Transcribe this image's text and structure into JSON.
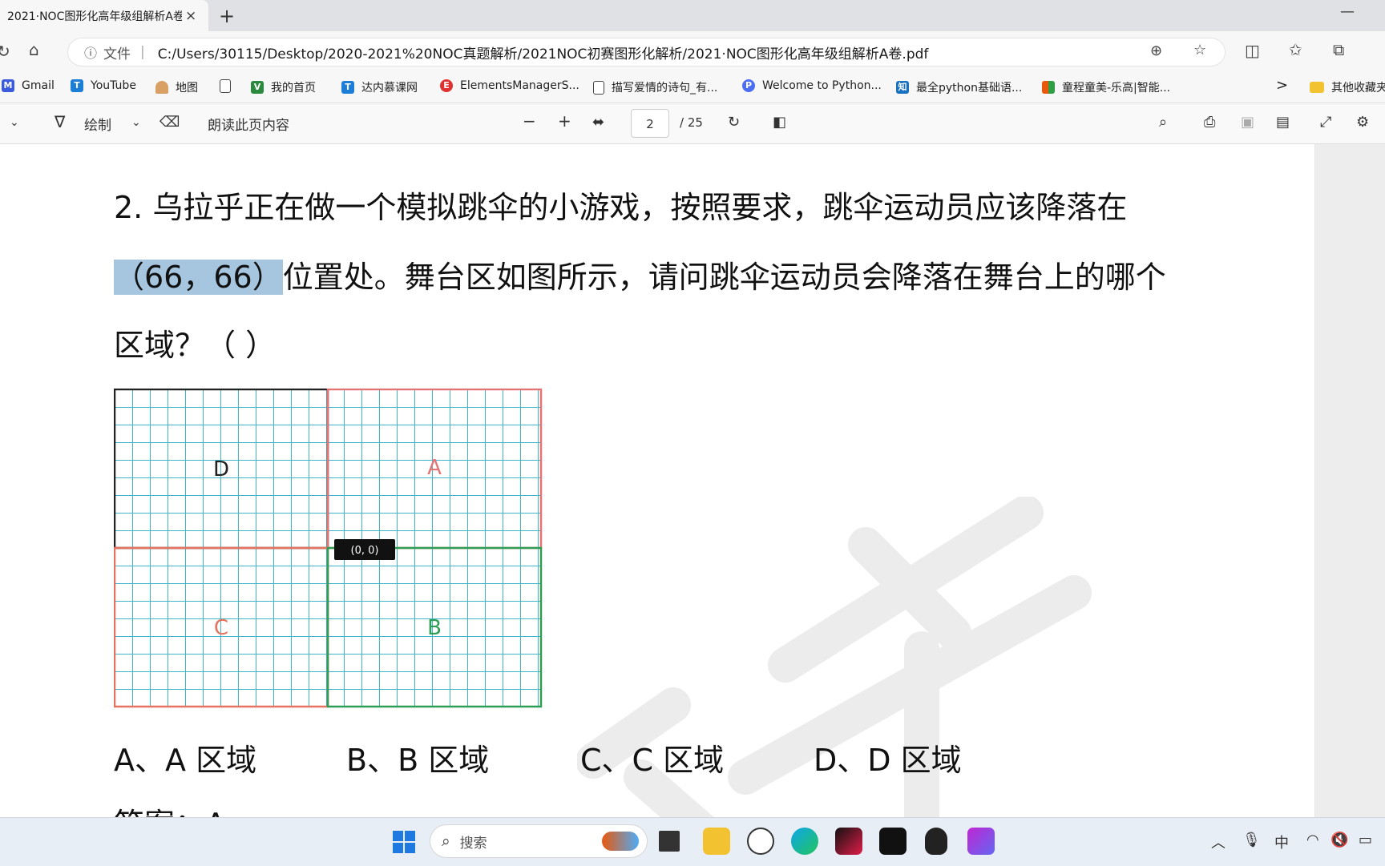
{
  "browser": {
    "tab_title": "2021·NOC图形化高年级组解析A卷",
    "close_glyph": "×",
    "new_tab_glyph": "+",
    "minimize_glyph": "—",
    "address": {
      "scheme_label": "文件",
      "separator": "|",
      "url": "C:/Users/30115/Desktop/2020-2021%20NOC真题解析/2021NOC初赛图形化解析/2021·NOC图形化高年级组解析A卷.pdf"
    },
    "bookmarks": [
      {
        "label": "Gmail",
        "color": "#3b5bdb",
        "glyph": "M"
      },
      {
        "label": "YouTube",
        "color": "#1c7ed6",
        "glyph": "T"
      },
      {
        "label": "地图",
        "color": "#d9a066",
        "glyph": ""
      },
      {
        "label": "",
        "color": "#ffffff",
        "glyph": ""
      },
      {
        "label": "我的首页",
        "color": "#2b8a3e",
        "glyph": "V"
      },
      {
        "label": "达内慕课网",
        "color": "#1c7ed6",
        "glyph": "T"
      },
      {
        "label": "ElementsManagerS...",
        "color": "#e03131",
        "glyph": "E"
      },
      {
        "label": "描写爱情的诗句_有...",
        "color": "#ffffff",
        "glyph": ""
      },
      {
        "label": "Welcome to Python...",
        "color": "#4c6ef5",
        "glyph": "P"
      },
      {
        "label": "最全python基础语...",
        "color": "#1971c2",
        "glyph": "知"
      },
      {
        "label": "童程童美-乐高|智能...",
        "color": "#e8590c",
        "glyph": "■"
      }
    ],
    "more_bookmarks_glyph": ">",
    "other_bookmarks": "其他收藏夹"
  },
  "pdf_toolbar": {
    "draw_label": "绘制",
    "read_aloud_label": "朗读此页内容",
    "zoom_out": "−",
    "zoom_in": "+",
    "page_current": "2",
    "page_total": "/ 25"
  },
  "document": {
    "line1": "2. 乌拉乎正在做一个模拟跳伞的小游戏，按照要求，跳伞运动员应该降落在",
    "line2_highlight": "（66，66）",
    "line2_rest": "位置处。舞台区如图所示，请问跳伞运动员会降落在舞台上的哪个",
    "line3": "区域？（     ）",
    "grid": {
      "quadrants": [
        {
          "label": "D",
          "color": "#222222"
        },
        {
          "label": "A",
          "color": "#e57373"
        },
        {
          "label": "C",
          "color": "#e57360"
        },
        {
          "label": "B",
          "color": "#2e9e55"
        }
      ],
      "origin_label": "(0, 0)",
      "grid_line_color": "#3fb4c8"
    },
    "options": [
      "A、A 区域",
      "B、B 区域",
      "C、C 区域",
      "D、D 区域"
    ],
    "answer_partial": "答案：A"
  },
  "taskbar": {
    "search_placeholder": "搜索",
    "ime_label": "中"
  }
}
